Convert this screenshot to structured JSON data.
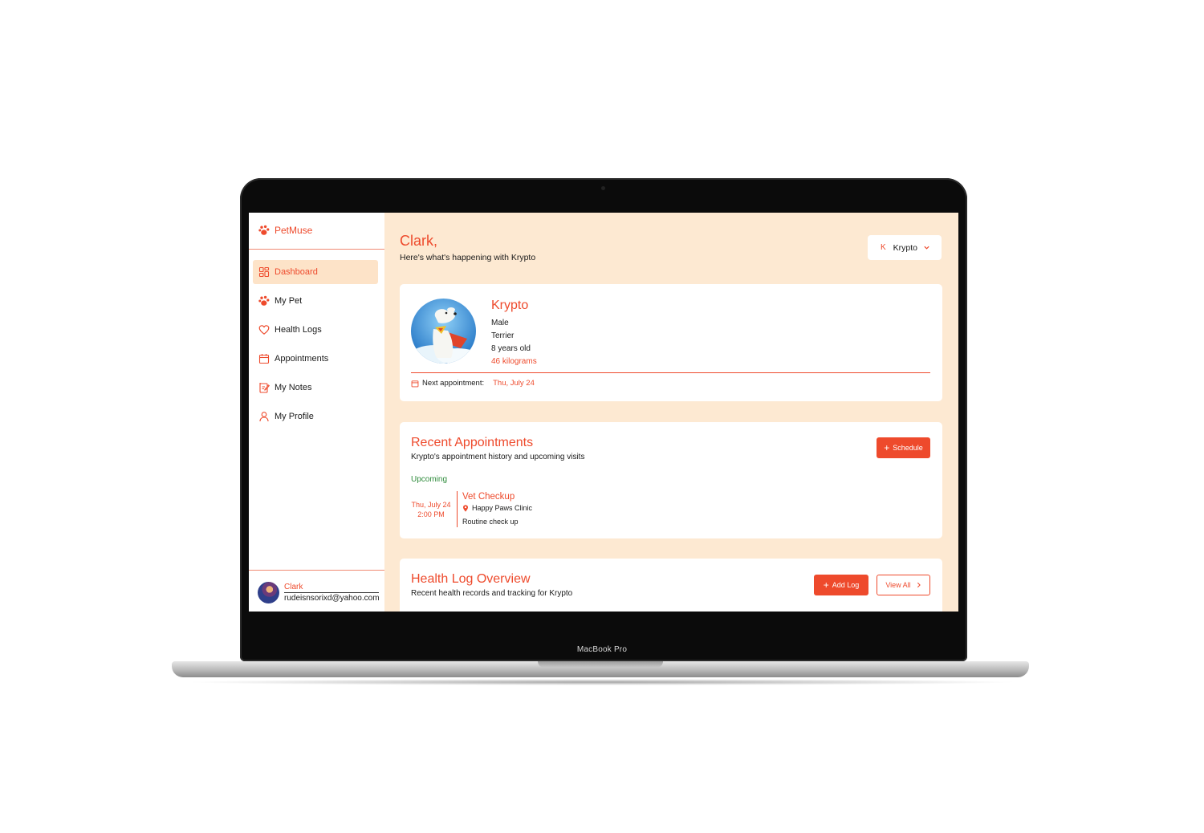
{
  "device": {
    "model_label": "MacBook Pro"
  },
  "colors": {
    "accent": "#ee4a2c",
    "background": "#fde9d2",
    "upcoming": "#2e8b3b"
  },
  "sidebar": {
    "brand": "PetMuse",
    "items": [
      {
        "label": "Dashboard",
        "icon": "grid-icon",
        "active": true
      },
      {
        "label": "My Pet",
        "icon": "paw-icon"
      },
      {
        "label": "Health Logs",
        "icon": "heart-icon"
      },
      {
        "label": "Appointments",
        "icon": "calendar-icon"
      },
      {
        "label": "My Notes",
        "icon": "note-icon"
      },
      {
        "label": "My Profile",
        "icon": "user-icon"
      }
    ],
    "user": {
      "name": "Clark",
      "email": "rudeisnsorixd@yahoo.com"
    }
  },
  "header": {
    "greeting": "Clark,",
    "subtitle": "Here's what's happening with Krypto",
    "pet_selector": {
      "initial": "K",
      "value": "Krypto"
    }
  },
  "pet": {
    "name": "Krypto",
    "sex": "Male",
    "breed": "Terrier",
    "age": "8 years old",
    "weight": "46 kilograms",
    "next_appointment_label": "Next appointment:",
    "next_appointment_date": "Thu, July 24"
  },
  "recent_appointments": {
    "title": "Recent Appointments",
    "subtitle": "Krypto's appointment history and upcoming visits",
    "schedule_label": "Schedule",
    "section_label": "Upcoming",
    "items": [
      {
        "date": "Thu, July 24",
        "time": "2:00 PM",
        "title": "Vet Checkup",
        "clinic": "Happy Paws Clinic",
        "note": "Routine check up"
      }
    ]
  },
  "health_log": {
    "title": "Health Log Overview",
    "subtitle": "Recent health records and tracking for Krypto",
    "add_label": "Add Log",
    "view_all_label": "View All"
  }
}
